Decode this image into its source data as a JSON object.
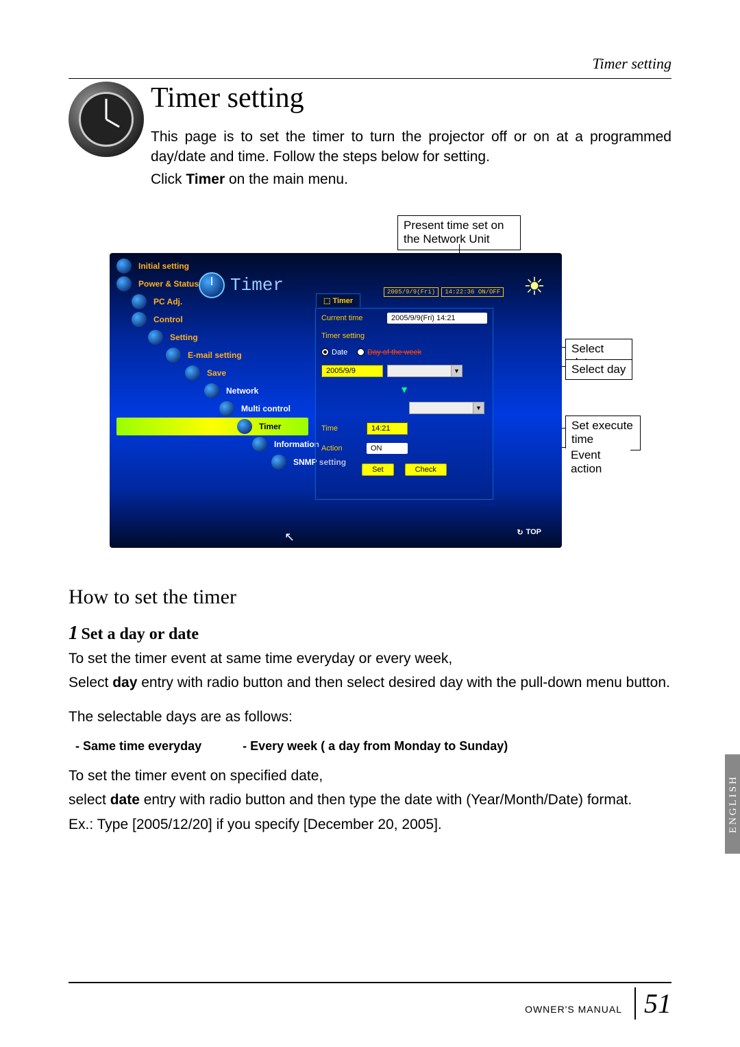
{
  "header_label": "Timer setting",
  "title": "Timer setting",
  "intro": "This page is to set the timer to turn the projector off or on at a programmed day/date and time. Follow the steps below for setting.",
  "click_prefix": "Click ",
  "click_bold": "Timer",
  "click_suffix": " on the main menu.",
  "callouts": {
    "present_time": "Present time set on the Network Unit",
    "select_date": "Select date",
    "select_day": "Select day",
    "set_execute": "Set execute time",
    "event_action": "Event action"
  },
  "ui": {
    "nav": [
      "Initial setting",
      "Power & Status",
      "PC Adj.",
      "Control",
      "Setting",
      "E-mail setting",
      "Save",
      "Network",
      "Multi control",
      "Timer",
      "Information",
      "SNMP setting"
    ],
    "header": "Timer",
    "status_date": "2005/9/9(Fri)",
    "status_time": "14:22:36  ON/OFF",
    "panel_title": "Timer",
    "current_time_label": "Current time",
    "current_time_value": "2005/9/9(Fri) 14:21",
    "timer_setting_label": "Timer setting",
    "radio_date": "Date",
    "radio_day": "Day of the week",
    "date_input": "2005/9/9",
    "time_label": "Time",
    "time_value": "14:21",
    "action_label": "Action",
    "action_value": "ON",
    "btn_set": "Set",
    "btn_check": "Check",
    "top": "TOP"
  },
  "how_heading": "How to set the timer",
  "step_num": "1",
  "step_title": "Set a day or date",
  "p1": "To set the timer event at same time everyday or every week,",
  "p2_a": "Select ",
  "p2_bold": "day",
  "p2_b": " entry with radio button and then select desired day with the pull-down menu button.",
  "p3": "The selectable days are as follows:",
  "sel_a": "- Same time everyday",
  "sel_b": "- Every week ( a day from Monday to Sunday)",
  "p4": "To set the timer event on specified date,",
  "p5_a": "select ",
  "p5_bold": "date",
  "p5_b": " entry with radio button and then type the date with (Year/Month/Date) format.",
  "p6": "Ex.: Type [2005/12/20] if you specify [December 20, 2005].",
  "lang_tab": "ENGLISH",
  "page_num": "51",
  "doc_name": "OWNER'S MANUAL"
}
